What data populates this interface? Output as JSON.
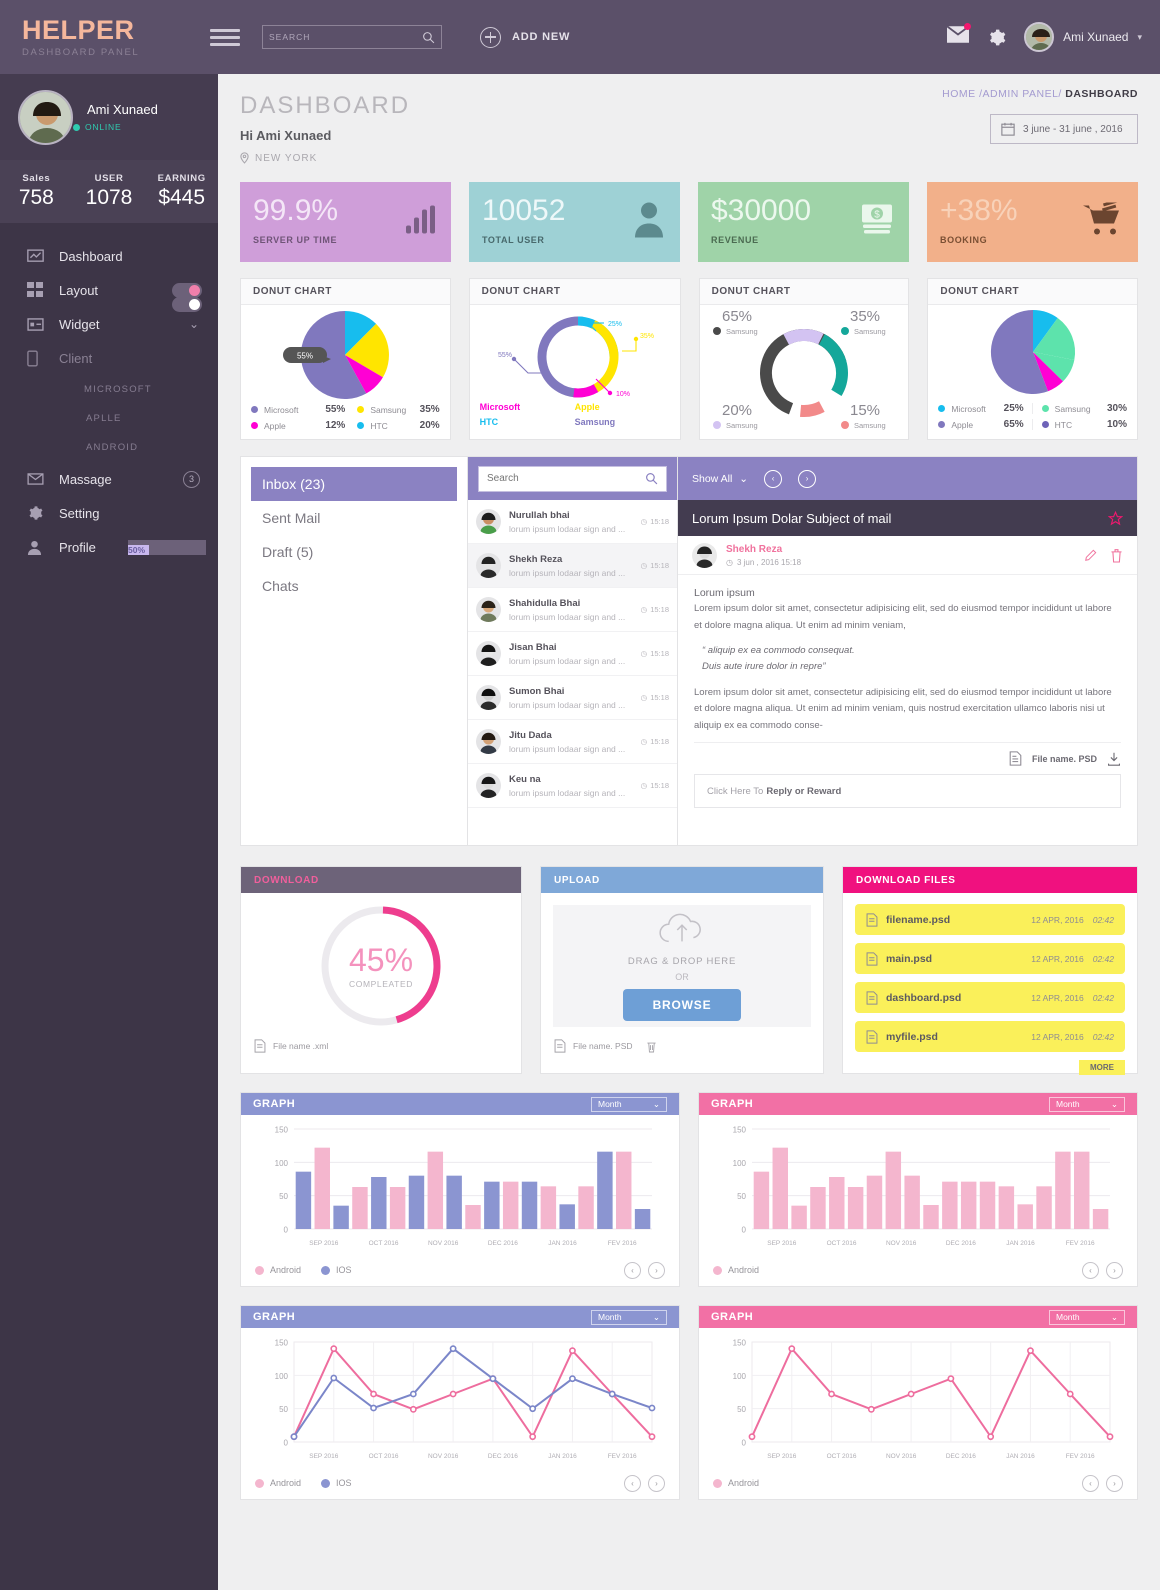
{
  "brand": {
    "title": "HELPER",
    "subtitle": "DASHBOARD PANEL"
  },
  "topbar": {
    "search_placeholder": "SEARCH",
    "search_value": "",
    "add_new_label": "ADD NEW",
    "user_name": "Ami Xunaed"
  },
  "sidebar": {
    "profile": {
      "name": "Ami Xunaed",
      "status": "ONLINE"
    },
    "stats": [
      {
        "key": "Sales",
        "value": "758"
      },
      {
        "key": "USER",
        "value": "1078"
      },
      {
        "key": "EARNING",
        "value": "$445"
      }
    ],
    "items": [
      {
        "label": "Dashboard",
        "icon": "monitor-icon"
      },
      {
        "label": "Layout",
        "icon": "grid-icon"
      },
      {
        "label": "Widget",
        "icon": "widget-icon"
      },
      {
        "label": "Client",
        "icon": "mobile-icon"
      }
    ],
    "sub_items": [
      "MICROSOFT",
      "APLLE",
      "ANDROID"
    ],
    "bottom_items": [
      {
        "label": "Massage",
        "icon": "envelope-icon",
        "badge": "3"
      },
      {
        "label": "Setting",
        "icon": "gear-icon"
      },
      {
        "label": "Profile",
        "icon": "person-icon",
        "progress": "50%"
      }
    ]
  },
  "page": {
    "title": "DASHBOARD",
    "greeting": "Hi Ami Xunaed",
    "location": "NEW YORK",
    "breadcrumb_links": "HOME /ADMIN PANEL/",
    "breadcrumb_current": "DASHBOARD",
    "date_range": "3 june  -  31 june , 2016"
  },
  "stat_cards": [
    {
      "value": "99.9%",
      "caption": "SERVER UP TIME",
      "bg": "#cf9ed9",
      "num_color": "#f4e6f7",
      "cap_color": "#6f5477",
      "icon": "bar-chart-icon"
    },
    {
      "value": "10052",
      "caption": "TOTAL USER",
      "bg": "#9ed1d5",
      "num_color": "#eef8f9",
      "cap_color": "#48696c",
      "icon": "user-icon"
    },
    {
      "value": "$30000",
      "caption": "REVENUE",
      "bg": "#9fd3a8",
      "num_color": "#ecf8ee",
      "cap_color": "#4b6b51",
      "icon": "money-icon"
    },
    {
      "value": "+38%",
      "caption": "BOOKING",
      "bg": "#f2b08a",
      "num_color": "#f8d2b9",
      "cap_color": "#7a4f33",
      "icon": "cart-icon"
    }
  ],
  "chart_data": [
    {
      "type": "pie",
      "title": "DONUT CHART",
      "categories": [
        "Microsoft",
        "Samsung",
        "Apple",
        "HTC"
      ],
      "values": [
        55,
        35,
        12,
        20
      ],
      "colors": [
        "#8078be",
        "#ffe500",
        "#ff00d4",
        "#17bdee"
      ],
      "labels": [
        "55%",
        "35%",
        "12%",
        "20%"
      ],
      "tooltip": "55%",
      "legend": "bottom"
    },
    {
      "type": "pie",
      "title": "DONUT CHART",
      "categories": [
        "Microsoft",
        "Apple",
        "HTC",
        "Samsung"
      ],
      "values": [
        10,
        35,
        25,
        55
      ],
      "colors": [
        "#ff00d4",
        "#ffe500",
        "#17bdee",
        "#8078be"
      ],
      "callouts": [
        "25%",
        "35%",
        "10%",
        "55%"
      ],
      "legend": "bottom-colored"
    },
    {
      "type": "pie",
      "title": "DONUT CHART",
      "categories": [
        "Samsung",
        "Samsung",
        "Samsung",
        "Samsung"
      ],
      "values": [
        65,
        35,
        20,
        15
      ],
      "colors": [
        "#4a4a4a",
        "#14a79a",
        "#d3c3f2",
        "#f28a8a"
      ],
      "corner_labels": [
        {
          "pct": "65%",
          "name": "Samsung",
          "color": "#4a4a4a"
        },
        {
          "pct": "35%",
          "name": "Samsung",
          "color": "#14a79a"
        },
        {
          "pct": "20%",
          "name": "Samsung",
          "color": "#d3c3f2"
        },
        {
          "pct": "15%",
          "name": "Samsung",
          "color": "#f28a8a"
        }
      ],
      "legend": "corners"
    },
    {
      "type": "pie",
      "title": "DONUT CHART",
      "categories": [
        "Microsoft",
        "Samsung",
        "Apple",
        "HTC"
      ],
      "values": [
        25,
        30,
        65,
        10
      ],
      "colors": [
        "#17bdee",
        "#5de3ac",
        "#8078be",
        "#6e63b8"
      ],
      "labels": [
        "25%",
        "30%",
        "65%",
        "10%"
      ],
      "legend": "bottom"
    },
    {
      "type": "bar",
      "title": "GRAPH",
      "header_color": "#8b95d1",
      "categories": [
        "SEP 2016",
        "OCT 2016",
        "NOV 2016",
        "DEC 2016",
        "JAN 2016",
        "FEV 2016"
      ],
      "tick_labels": [
        "0",
        "50",
        "100",
        "150"
      ],
      "ylim": [
        0,
        150
      ],
      "values": [
        86,
        122,
        35,
        63,
        78,
        63,
        80,
        116,
        80,
        36,
        71,
        71,
        71,
        64,
        37,
        64,
        116,
        116,
        30
      ],
      "series": [
        {
          "name": "Android",
          "color": "#f4b6ce"
        },
        {
          "name": "IOS",
          "color": "#8b95d1"
        }
      ],
      "bar_series": [
        "IOS",
        "Android",
        "IOS",
        "Android",
        "IOS",
        "Android",
        "IOS",
        "Android",
        "IOS",
        "Android",
        "IOS",
        "Android",
        "IOS",
        "Android",
        "IOS",
        "Android",
        "IOS",
        "Android",
        "IOS"
      ],
      "select_label": "Month"
    },
    {
      "type": "bar",
      "title": "GRAPH",
      "header_color": "#f270a5",
      "categories": [
        "SEP 2016",
        "OCT 2016",
        "NOV 2016",
        "DEC 2016",
        "JAN 2016",
        "FEV 2016"
      ],
      "tick_labels": [
        "0",
        "50",
        "100",
        "150"
      ],
      "ylim": [
        0,
        150
      ],
      "values": [
        86,
        122,
        35,
        63,
        78,
        63,
        80,
        116,
        80,
        36,
        71,
        71,
        71,
        64,
        37,
        64,
        116,
        116,
        30
      ],
      "series": [
        {
          "name": "Android",
          "color": "#f4b6ce"
        }
      ],
      "select_label": "Month"
    },
    {
      "type": "line",
      "title": "GRAPH",
      "header_color": "#8b95d1",
      "categories": [
        "SEP 2016",
        "OCT 2016",
        "NOV 2016",
        "DEC 2016",
        "JAN 2016",
        "FEV 2016"
      ],
      "tick_labels": [
        "0",
        "50",
        "100",
        "150"
      ],
      "ylim": [
        0,
        150
      ],
      "series": [
        {
          "name": "Android",
          "color": "#ee6d9e",
          "values": [
            8,
            140,
            72,
            49,
            72,
            95,
            8,
            137,
            72,
            8
          ]
        },
        {
          "name": "IOS",
          "color": "#7b86c9",
          "values": [
            8,
            96,
            51,
            72,
            140,
            95,
            50,
            95,
            72,
            51
          ]
        }
      ],
      "select_label": "Month"
    },
    {
      "type": "line",
      "title": "GRAPH",
      "header_color": "#f270a5",
      "categories": [
        "SEP 2016",
        "OCT 2016",
        "NOV 2016",
        "DEC 2016",
        "JAN 2016",
        "FEV 2016"
      ],
      "tick_labels": [
        "0",
        "50",
        "100",
        "150"
      ],
      "ylim": [
        0,
        150
      ],
      "series": [
        {
          "name": "Android",
          "color": "#ee6d9e",
          "values": [
            8,
            140,
            72,
            49,
            72,
            95,
            8,
            137,
            72,
            8
          ]
        }
      ],
      "select_label": "Month"
    }
  ],
  "mail": {
    "nav": [
      {
        "label": "Inbox (23)",
        "active": true
      },
      {
        "label": "Sent Mail",
        "active": false
      },
      {
        "label": "Draft (5)",
        "active": false
      },
      {
        "label": "Chats",
        "active": false
      }
    ],
    "search_placeholder": "Search",
    "search_value": "",
    "list": [
      {
        "name": "Nurullah bhai",
        "preview": "lorum ipsum lodaar sign and ...",
        "time": "15:18",
        "selected": false,
        "hair": "#1d1d1d",
        "skin": "#c98f63",
        "shirt": "#4a9e4a"
      },
      {
        "name": "Shekh Reza",
        "preview": "lorum ipsum lodaar sign and ...",
        "time": "15:18",
        "selected": true,
        "hair": "#232323",
        "skin": "#e6e6e6",
        "shirt": "#2a2a2a"
      },
      {
        "name": "Shahidulla Bhai",
        "preview": "lorum ipsum lodaar sign and ...",
        "time": "15:18",
        "selected": false,
        "hair": "#2a2218",
        "skin": "#d8a87a",
        "shirt": "#6f7a5c"
      },
      {
        "name": "Jisan Bhai",
        "preview": "lorum ipsum lodaar sign and ...",
        "time": "15:18",
        "selected": false,
        "hair": "#141414",
        "skin": "#e8e8e8",
        "shirt": "#1f1f1f"
      },
      {
        "name": "Sumon Bhai",
        "preview": "lorum ipsum lodaar sign and ...",
        "time": "15:18",
        "selected": false,
        "hair": "#0f0f0f",
        "skin": "#cfcfcf",
        "shirt": "#2b2b2b"
      },
      {
        "name": "Jitu Dada",
        "preview": "lorum ipsum lodaar sign and ...",
        "time": "15:18",
        "selected": false,
        "hair": "#241a12",
        "skin": "#d2a176",
        "shirt": "#333b46"
      },
      {
        "name": "Keu na",
        "preview": "lorum ipsum lodaar sign and ...",
        "time": "15:18",
        "selected": false,
        "hair": "#181818",
        "skin": "#dcdcdc",
        "shirt": "#242424"
      }
    ],
    "show_all_label": "Show All",
    "subject": "Lorum Ipsum Dolar Subject of mail",
    "sender": "Shekh Reza",
    "sent_at": "3 jun , 2016   15:18",
    "body_heading": "Lorum ipsum",
    "body_p1": "Lorem ipsum dolor sit amet, consectetur adipisicing elit, sed do eiusmod tempor incididunt ut labore et dolore magna aliqua. Ut enim ad minim veniam,",
    "body_quote_l1": "“ aliquip ex ea commodo consequat.",
    "body_quote_l2": "Duis aute irure dolor in repre”",
    "body_p2": "Lorem ipsum dolor sit amet, consectetur adipisicing elit, sed do eiusmod tempor incididunt ut labore et dolore magna aliqua. Ut enim ad minim veniam, quis nostrud exercitation ullamco laboris nisi ut aliquip ex ea commodo conse-",
    "attachment": "File name. PSD",
    "reply_pre": "Click Here To",
    "reply_bold": "Reply or Reward"
  },
  "download": {
    "title": "DOWNLOAD",
    "header_bg": "#6d6379",
    "title_color": "#f05f9c",
    "percent": "45%",
    "percent_value": 45,
    "sub": "COMPLEATED",
    "file_name": "File name .xml",
    "ring_color": "#ee3d8e"
  },
  "upload": {
    "title": "UPLOAD",
    "header_bg": "#7fa8d8",
    "title_color": "#ffffff",
    "drop_label": "DRAG & DROP HERE",
    "or_label": "OR",
    "browse_label": "BROWSE",
    "file_name": "File name. PSD"
  },
  "download_files": {
    "title": "DOWNLOAD FILES",
    "header_bg": "#f0117f",
    "title_color": "#ffffff",
    "more_label": "MORE",
    "rows": [
      {
        "name": "filename.psd",
        "date": "12 APR, 2016",
        "time": "02:42"
      },
      {
        "name": "main.psd",
        "date": "12 APR, 2016",
        "time": "02:42"
      },
      {
        "name": "dashboard.psd",
        "date": "12 APR, 2016",
        "time": "02:42"
      },
      {
        "name": "myfile.psd",
        "date": "12 APR, 2016",
        "time": "02:42"
      }
    ]
  }
}
